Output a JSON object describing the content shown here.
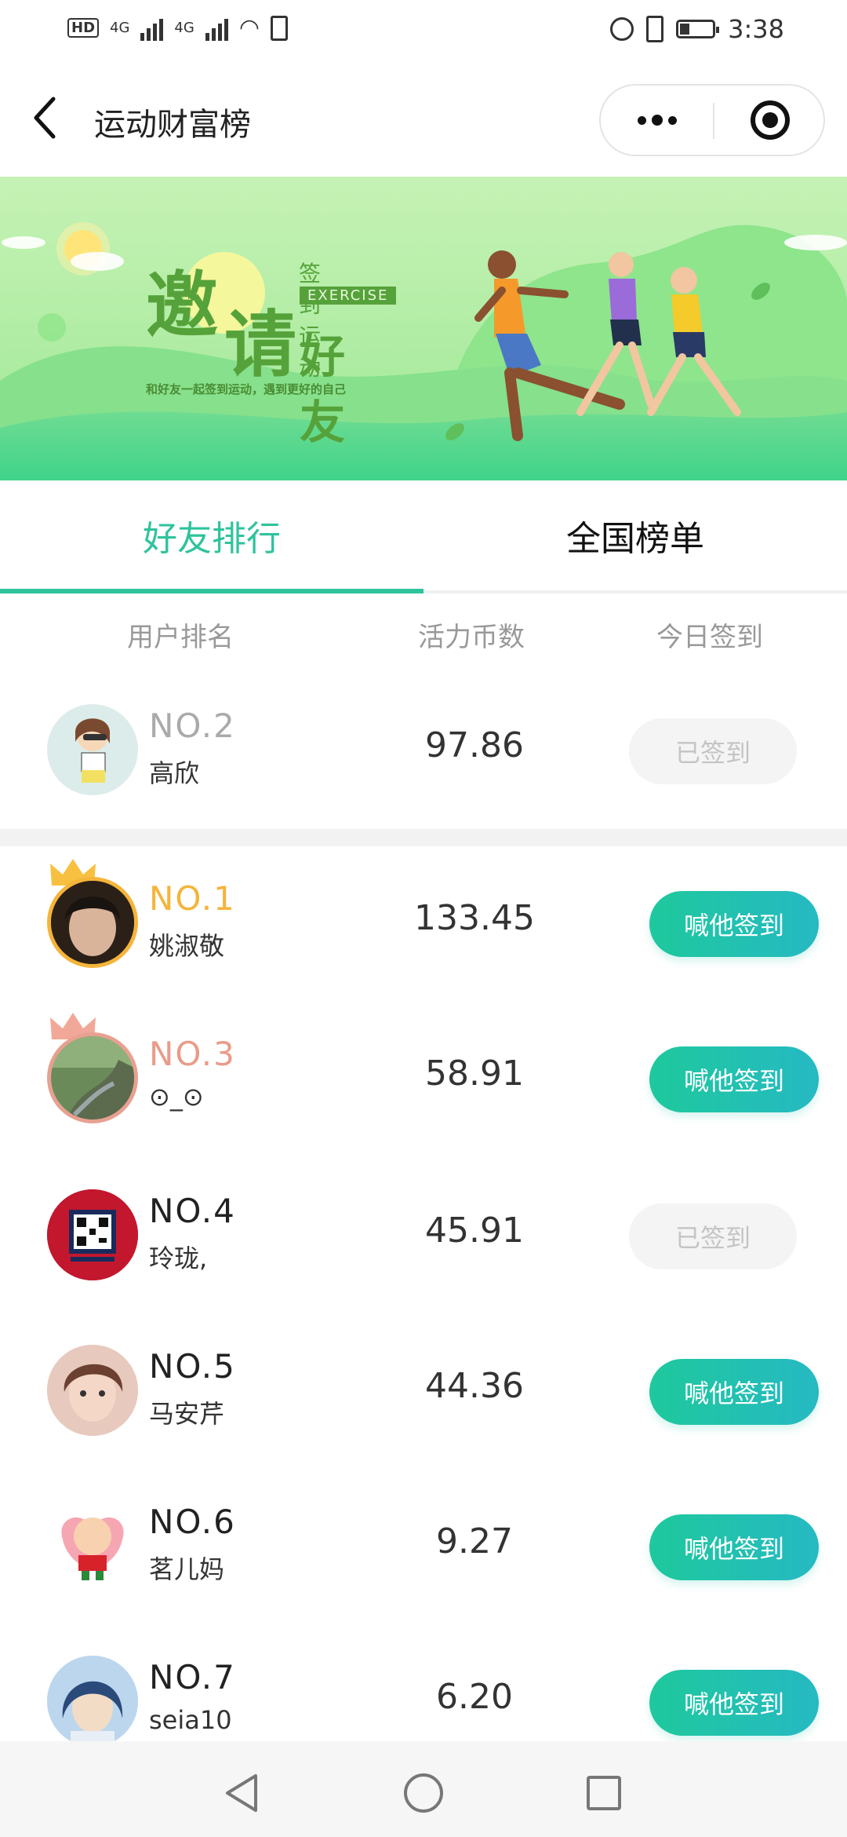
{
  "status_bar": {
    "network_left": "HD",
    "net1": "4G",
    "net2": "4G",
    "time": "3:38"
  },
  "nav": {
    "title": "运动财富榜",
    "icons": [
      "back-icon",
      "more-icon",
      "close-miniprogram-icon"
    ]
  },
  "banner": {
    "char1": "邀",
    "char2": "请",
    "friends": "好友",
    "top_text": "签到运动",
    "badge": "EXERCISE",
    "subtitle": "和好友一起签到运动，遇到更好的自己"
  },
  "tabs": [
    {
      "label": "好友排行",
      "active": true
    },
    {
      "label": "全国榜单",
      "active": false
    }
  ],
  "headers": {
    "rank": "用户排名",
    "coins": "活力币数",
    "checkin": "今日签到"
  },
  "self_row": {
    "rank": "NO.2",
    "name": "高欣",
    "coins": "97.86",
    "status": "已签到"
  },
  "rows": [
    {
      "rank": "NO.1",
      "name": "姚淑敬",
      "coins": "133.45",
      "action": "喊他签到",
      "rank_color": "#f5b43a"
    },
    {
      "rank": "NO.3",
      "name": "⊙_⊙",
      "coins": "58.91",
      "action": "喊他签到",
      "rank_color": "#e89c8a"
    },
    {
      "rank": "NO.4",
      "name": "玲珑,",
      "coins": "45.91",
      "action": "已签到",
      "rank_color": "#222222"
    },
    {
      "rank": "NO.5",
      "name": "马安芹",
      "coins": "44.36",
      "action": "喊他签到",
      "rank_color": "#222222"
    },
    {
      "rank": "NO.6",
      "name": "茗儿妈",
      "coins": "9.27",
      "action": "喊他签到",
      "rank_color": "#222222"
    },
    {
      "rank": "NO.7",
      "name": "seia10",
      "coins": "6.20",
      "action": "喊他签到",
      "rank_color": "#222222"
    }
  ],
  "colors": {
    "accent": "#2fc39c",
    "gold": "#f5b43a",
    "bronze": "#e89c8a"
  }
}
